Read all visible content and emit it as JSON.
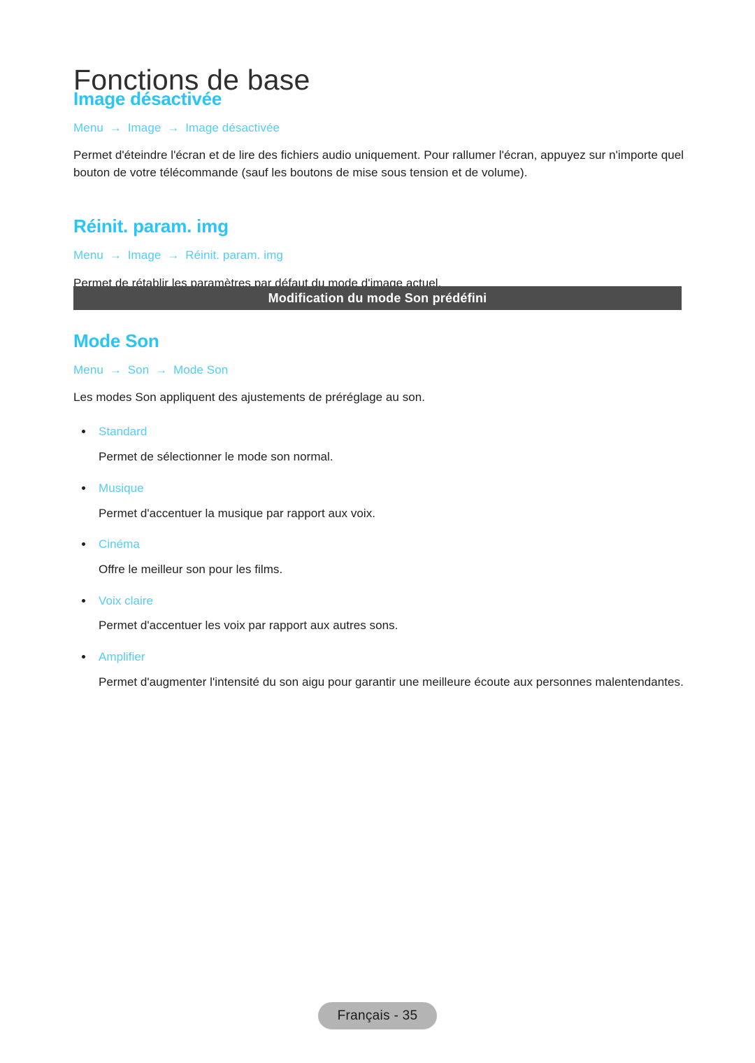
{
  "page": {
    "chapter_title": "Fonctions de base",
    "accent_color": "#29c5f5",
    "breadcrumb_color": "#52cdf6",
    "banner_bg_color": "#4d4d4d",
    "footer_bg_color": "#b4b4b4"
  },
  "arrow_glyph": "→",
  "sections": [
    {
      "heading": "Image désactivée",
      "breadcrumb": [
        "Menu",
        "Image",
        "Image désactivée"
      ],
      "body": "Permet d'éteindre l'écran et de lire des fichiers audio uniquement. Pour rallumer l'écran, appuyez sur n'importe quel bouton de votre télécommande (sauf les boutons de mise sous tension et de volume)."
    },
    {
      "heading": "Réinit. param. img",
      "breadcrumb": [
        "Menu",
        "Image",
        "Réinit. param. img"
      ],
      "body": "Permet de rétablir les paramètres par défaut du mode d'image actuel."
    }
  ],
  "banner": {
    "title": "Modification du mode Son prédéfini"
  },
  "sound_mode": {
    "heading": "Mode Son",
    "breadcrumb": [
      "Menu",
      "Son",
      "Mode Son"
    ],
    "body": "Les modes Son appliquent des ajustements de préréglage au son.",
    "options": [
      {
        "label": "Standard",
        "description": "Permet de sélectionner le mode son normal."
      },
      {
        "label": "Musique",
        "description": "Permet d'accentuer la musique par rapport aux voix."
      },
      {
        "label": "Cinéma",
        "description": "Offre le meilleur son pour les films."
      },
      {
        "label": "Voix claire",
        "description": "Permet d'accentuer les voix par rapport aux autres sons."
      },
      {
        "label": "Amplifier",
        "description": "Permet d'augmenter l'intensité du son aigu pour garantir une meilleure écoute aux personnes malentendantes."
      }
    ]
  },
  "footer": {
    "label": "Français - 35"
  }
}
